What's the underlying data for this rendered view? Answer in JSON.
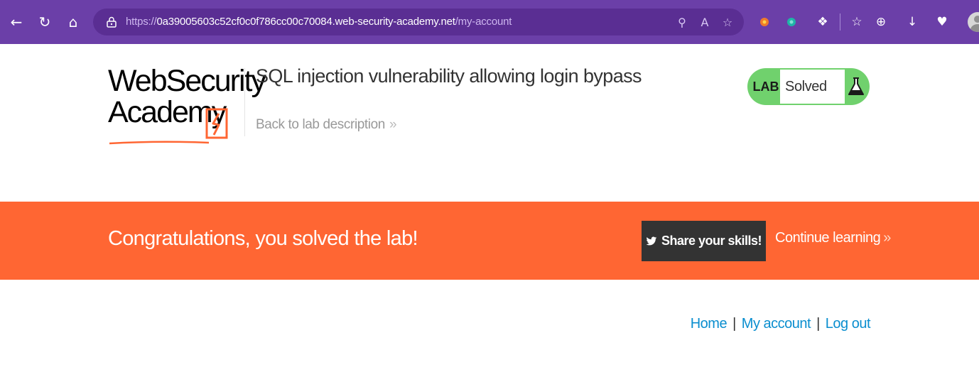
{
  "browser": {
    "url_protocol": "https://",
    "url_host": "0a39005603c52cf0c0f786cc00c70084.web-security-academy.net",
    "url_path": "/my-account",
    "icons": [
      "back-icon",
      "refresh-icon",
      "home-icon",
      "lock-icon",
      "key-icon",
      "read-aloud-icon",
      "favorite-icon",
      "extension-icon",
      "split-screen-icon",
      "favorites-icon",
      "collections-icon",
      "download-icon",
      "health-icon",
      "profile-icon"
    ]
  },
  "header": {
    "logo_line1": "WebSecurity",
    "logo_line2": "Academy",
    "lab_title": "SQL injection vulnerability allowing login bypass",
    "back_link": "Back to lab description",
    "back_chevron": "»"
  },
  "lab_status": {
    "label": "LAB",
    "state": "Solved",
    "color": "#70d16d"
  },
  "banner": {
    "message": "Congratulations, you solved the lab!",
    "share_label": "Share your skills!",
    "continue_label": "Continue learning",
    "continue_chevron": "»",
    "color": "#ff6633"
  },
  "account_nav": {
    "home": "Home",
    "my_account": "My account",
    "log_out": "Log out",
    "separator": "|",
    "link_color": "#0a8ecf"
  }
}
